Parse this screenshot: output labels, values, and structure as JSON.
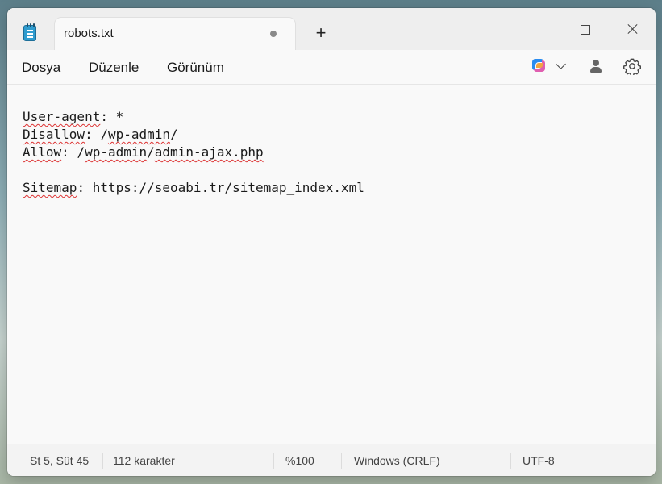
{
  "tab": {
    "title": "robots.txt"
  },
  "menu": {
    "file": "Dosya",
    "edit": "Düzenle",
    "view": "Görünüm"
  },
  "editor": {
    "line1": {
      "word": "User-agent",
      "rest": ": *"
    },
    "line2": {
      "word": "Disallow",
      "sep": ": /",
      "word2": "wp-admin",
      "rest": "/"
    },
    "line3": {
      "word": "Allow",
      "sep": ": /",
      "word2": "wp-admin",
      "sep2": "/",
      "word3": "admin-ajax.php"
    },
    "line5": {
      "word": "Sitemap",
      "rest": ": https://seoabi.tr/sitemap_index.xml"
    }
  },
  "status": {
    "position": "St 5, Süt 45",
    "chars": "112 karakter",
    "zoom": "%100",
    "line_ending": "Windows (CRLF)",
    "encoding": "UTF-8"
  },
  "icons": {
    "app": "notepad-icon",
    "unsaved": "unsaved-dot-icon",
    "new_tab": "plus-icon",
    "copilot": "copilot-icon",
    "account": "account-icon",
    "settings": "gear-icon"
  },
  "colors": {
    "spellcheck": "#d33",
    "app_icon": "#2f9ccf"
  }
}
